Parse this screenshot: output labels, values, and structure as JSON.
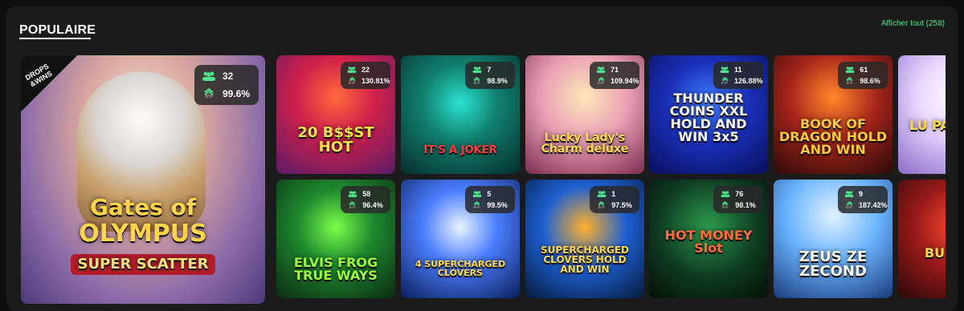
{
  "section": {
    "title": "POPULAIRE",
    "view_all": "Afficher tout (258)"
  },
  "featured": {
    "title_line1": "Gates of",
    "title_line2": "OLYMPUS",
    "title_line3": "SUPER SCATTER",
    "badge_line1": "DROPS",
    "badge_line2": "&WINS",
    "players": "32",
    "rtp": "99.6%",
    "rtp_label": "RTP"
  },
  "games": [
    {
      "title": "20 B$$ST HOT",
      "players": "22",
      "rtp": "130.81%",
      "rtp_label": "RTP"
    },
    {
      "title": "IT'S A JOKER",
      "players": "7",
      "rtp": "98.9%",
      "rtp_label": "RTP"
    },
    {
      "title": "Lucky Lady's Charm deluxe",
      "players": "71",
      "rtp": "109.94%",
      "rtp_label": "RTP"
    },
    {
      "title": "THUNDER COINS XXL HOLD AND WIN 3x5",
      "players": "11",
      "rtp": "126.88%",
      "rtp_label": "RTP"
    },
    {
      "title": "BOOK OF DRAGON HOLD AND WIN",
      "players": "61",
      "rtp": "98.6%",
      "rtp_label": "RTP"
    },
    {
      "title": "LU PA BONUS",
      "players": "",
      "rtp": "",
      "rtp_label": ""
    },
    {
      "title": "ELVIS FROG TRUE WAYS",
      "players": "58",
      "rtp": "96.4%",
      "rtp_label": "RTP"
    },
    {
      "title": "4 SUPERCHARGED CLOVERS",
      "players": "5",
      "rtp": "99.5%",
      "rtp_label": "RTP"
    },
    {
      "title": "SUPERCHARGED CLOVERS HOLD AND WIN",
      "players": "1",
      "rtp": "97.5%",
      "rtp_label": "RTP"
    },
    {
      "title": "HOT MONEY Slot",
      "players": "76",
      "rtp": "98.1%",
      "rtp_label": "RTP"
    },
    {
      "title": "ZEUS ZE ZECOND",
      "players": "9",
      "rtp": "187.42%",
      "rtp_label": "RTP"
    },
    {
      "title": "BU CHILL",
      "players": "",
      "rtp": "",
      "rtp_label": ""
    }
  ]
}
